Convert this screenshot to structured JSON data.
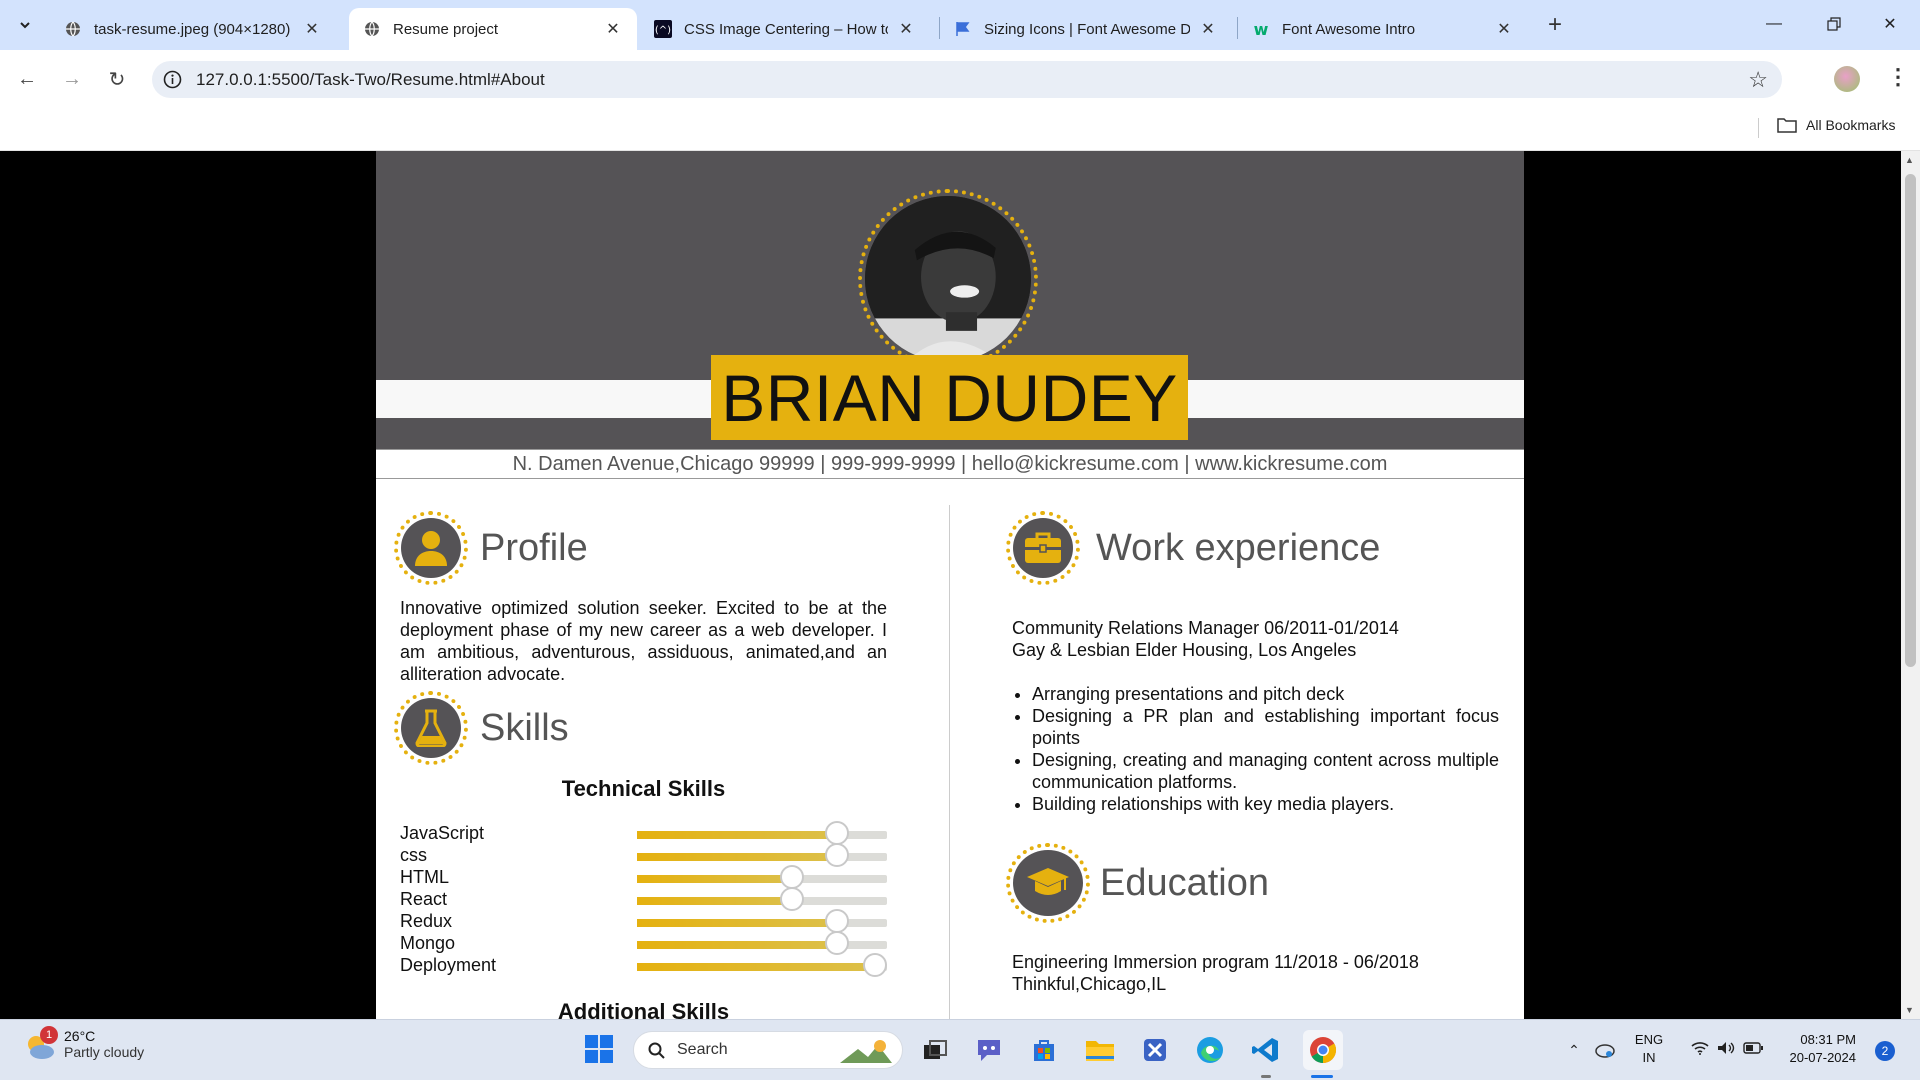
{
  "browser": {
    "tabs": [
      {
        "title": "task-resume.jpeg (904×1280)",
        "icon": "globe-icon",
        "active": false
      },
      {
        "title": "Resume project",
        "icon": "globe-icon",
        "active": true
      },
      {
        "title": "CSS Image Centering – How to",
        "icon": "freecodecamp-icon",
        "active": false
      },
      {
        "title": "Sizing Icons | Font Awesome Do",
        "icon": "font-awesome-flag-icon",
        "active": false
      },
      {
        "title": "Font Awesome Intro",
        "icon": "w3schools-icon",
        "active": false
      }
    ],
    "url": "127.0.0.1:5500/Task-Two/Resume.html#About",
    "bookmarks_label": "All Bookmarks"
  },
  "resume": {
    "name": "BRIAN DUDEY",
    "contact": "N. Damen Avenue,Chicago 99999 | 999-999-9999 | hello@kickresume.com | www.kickresume.com",
    "profile": {
      "title": "Profile",
      "text": "Innovative optimized solution seeker. Excited to be at the deployment phase of my new career as a web developer. I am ambitious, adventurous, assiduous, animated,and an alliteration advocate."
    },
    "skills": {
      "title": "Skills",
      "technical_heading": "Technical Skills",
      "additional_heading": "Additional Skills",
      "technical": [
        {
          "name": "JavaScript",
          "level": 0.8
        },
        {
          "name": "css",
          "level": 0.8
        },
        {
          "name": "HTML",
          "level": 0.62
        },
        {
          "name": "React",
          "level": 0.62
        },
        {
          "name": "Redux",
          "level": 0.8
        },
        {
          "name": "Mongo",
          "level": 0.8
        },
        {
          "name": "Deployment",
          "level": 0.95
        }
      ]
    },
    "work": {
      "title": "Work experience",
      "role": "Community Relations Manager 06/2011-01/2014",
      "company": "Gay & Lesbian Elder Housing, Los Angeles",
      "duties": [
        "Arranging presentations and pitch deck",
        "Designing a PR plan and establishing important focus points",
        "Designing, creating and managing content across multiple communication platforms.",
        "Building relationships with key media players."
      ]
    },
    "education": {
      "title": "Education",
      "program": "Engineering Immersion program 11/2018 - 06/2018",
      "school": "Thinkful,Chicago,IL"
    },
    "accent_color": "#e5b10f",
    "header_color": "#555356"
  },
  "taskbar": {
    "weather_temp": "26°C",
    "weather_cond": "Partly cloudy",
    "weather_badge": "1",
    "search_label": "Search",
    "lang_top": "ENG",
    "lang_bottom": "IN",
    "time": "08:31 PM",
    "date": "20-07-2024",
    "notification_count": "2"
  }
}
